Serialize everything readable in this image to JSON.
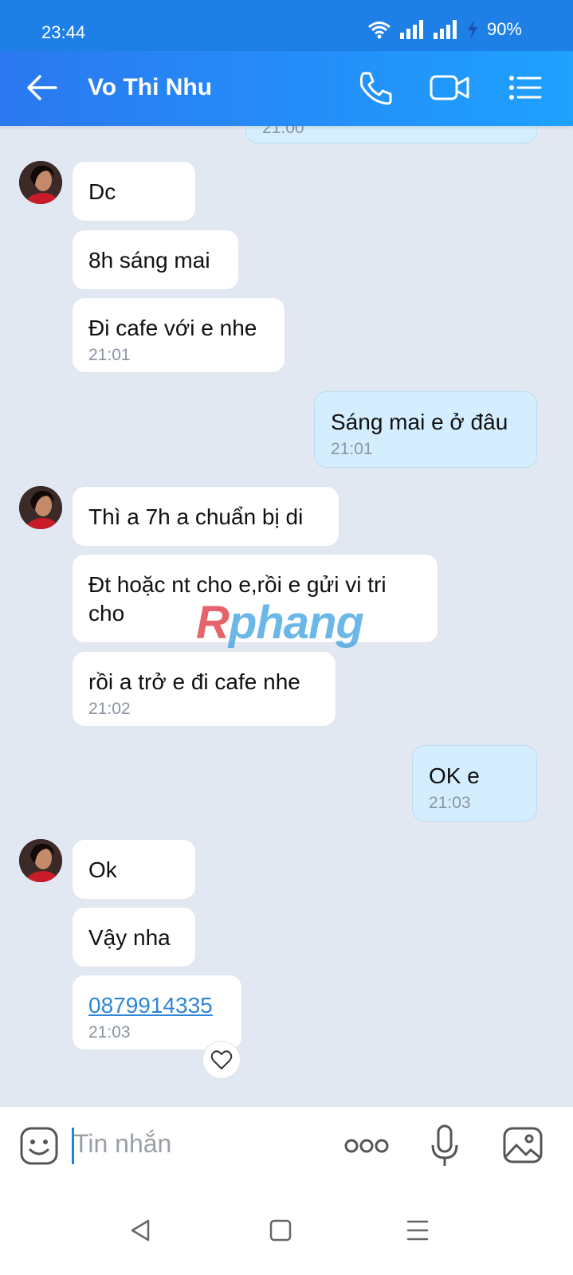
{
  "status": {
    "time": "23:44",
    "battery": "90%"
  },
  "header": {
    "contact_name": "Vo Thi Nhu"
  },
  "messages": {
    "prev_time": "21:00",
    "m1": {
      "text": "Dc"
    },
    "m2": {
      "text": "8h sáng mai"
    },
    "m3": {
      "text": "Đi cafe với e nhe",
      "time": "21:01"
    },
    "m4": {
      "text": "Sáng mai e ở đâu",
      "time": "21:01"
    },
    "m5": {
      "text": "Thì a 7h a chuẩn bị di"
    },
    "m6": {
      "text": "Đt hoặc nt cho e,rồi e gửi vi tri cho"
    },
    "m7": {
      "text": "rồi a trở e đi cafe nhe",
      "time": "21:02"
    },
    "m8": {
      "text": "OK e",
      "time": "21:03"
    },
    "m9": {
      "text": "Ok"
    },
    "m10": {
      "text": "Vậy nha"
    },
    "m11": {
      "text": "0879914335",
      "time": "21:03"
    }
  },
  "watermark": {
    "part1": "R",
    "part2": "phang"
  },
  "input": {
    "placeholder": "Tin nhắn"
  },
  "colors": {
    "header": "#1e7fe6",
    "chat_bg": "#e2e8f1",
    "own_bubble": "#d4eeff",
    "link": "#2f86d6"
  }
}
